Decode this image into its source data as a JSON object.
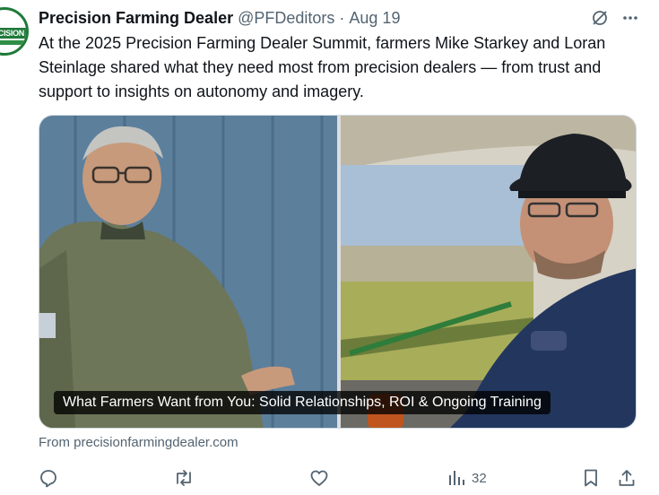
{
  "post": {
    "author_name": "Precision Farming Dealer",
    "author_handle": "@PFDeditors",
    "separator": "·",
    "date": "Aug 19",
    "avatar_text": "CISION",
    "text": "At the 2025 Precision Farming Dealer Summit, farmers Mike Starkey and Loran Steinlage shared what they need most from precision dealers — from trust and support to insights on autonomy and imagery."
  },
  "media": {
    "caption": "What Farmers Want from You: Solid Relationships, ROI & Ongoing Training"
  },
  "link_source": "From precisionfarmingdealer.com",
  "actions": {
    "views_count": "32"
  },
  "icons": {
    "grok": "grok-icon",
    "more": "more-icon",
    "reply": "reply-icon",
    "repost": "repost-icon",
    "like": "like-icon",
    "views": "views-icon",
    "bookmark": "bookmark-icon",
    "share": "share-icon"
  },
  "colors": {
    "text_primary": "#0f1419",
    "text_secondary": "#536471",
    "brand_green": "#1f7a3a",
    "border": "#cfd9de"
  }
}
